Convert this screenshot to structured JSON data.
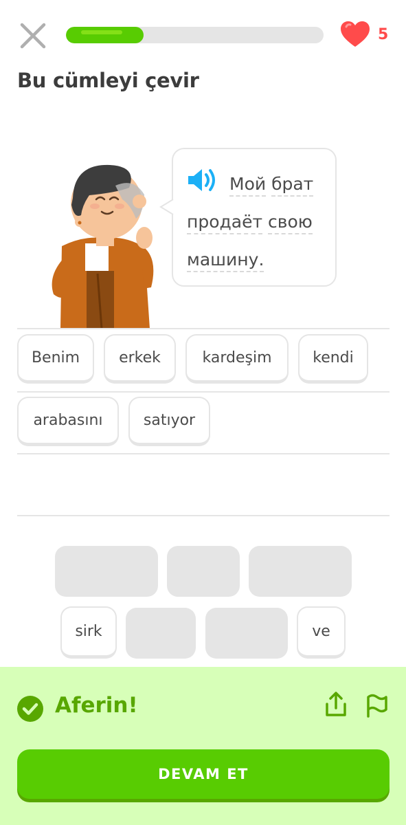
{
  "header": {
    "progress_percent": 30,
    "hearts": "5"
  },
  "prompt": {
    "title": "Bu cümleyi çevir",
    "sentence_words": [
      "Мой",
      "брат",
      "продаёт",
      "свою",
      "машину."
    ]
  },
  "answer": {
    "rows": [
      [
        "Benim",
        "erkek",
        "kardeşim",
        "kendi"
      ],
      [
        "arabasını",
        "satıyor"
      ]
    ]
  },
  "word_bank": {
    "visible_words": [
      "sirk",
      "ve"
    ]
  },
  "feedback": {
    "message": "Aferin!",
    "continue_label": "DEVAM ET"
  },
  "colors": {
    "brand_green": "#58cc02",
    "success_text": "#58a700",
    "feedback_bg": "#d7ffb8",
    "heart": "#ff4b4b",
    "speaker": "#1cb0f6"
  }
}
